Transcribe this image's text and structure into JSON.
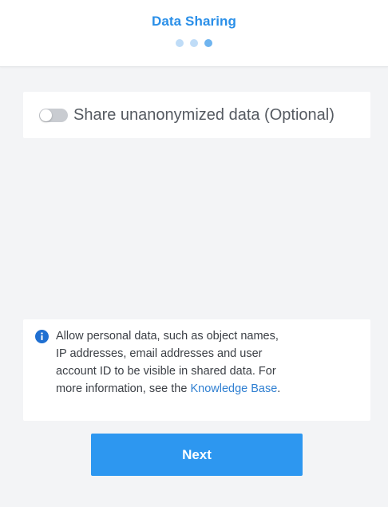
{
  "header": {
    "title": "Data Sharing",
    "steps": 3,
    "current_step": 3
  },
  "toggle": {
    "label": "Share unanonymized data (Optional)",
    "enabled": false
  },
  "info": {
    "icon": "info-icon",
    "text_before_link": "Allow personal data, such as object names, IP addresses, email addresses and user account ID to be visible in shared data. For more information, see the ",
    "link_text": "Knowledge Base",
    "text_after_link": "."
  },
  "actions": {
    "next_label": "Next"
  },
  "colors": {
    "accent": "#2d97f0",
    "title": "#2a8fe8",
    "link": "#2f7fd1",
    "info_icon": "#1f6fd1",
    "dot_inactive": "#bfdcf7",
    "dot_active": "#6fb4ef",
    "toggle_off": "#c9ccd1"
  }
}
